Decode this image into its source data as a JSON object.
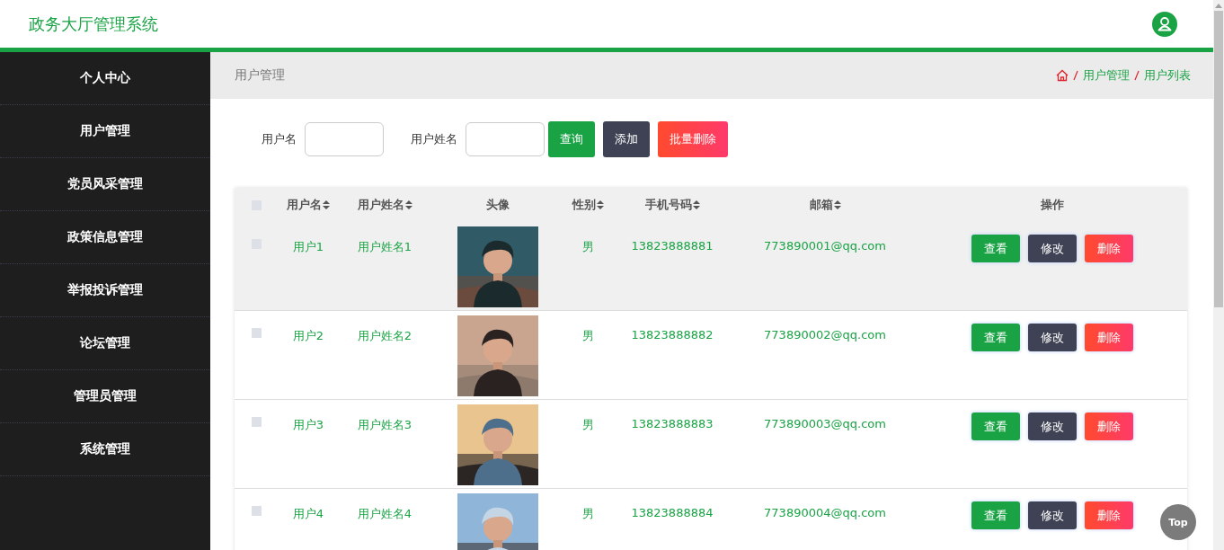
{
  "header": {
    "title": "政务大厅管理系统"
  },
  "sidebar": {
    "items": [
      {
        "label": "个人中心"
      },
      {
        "label": "用户管理"
      },
      {
        "label": "党员风采管理"
      },
      {
        "label": "政策信息管理"
      },
      {
        "label": "举报投诉管理"
      },
      {
        "label": "论坛管理"
      },
      {
        "label": "管理员管理"
      },
      {
        "label": "系统管理"
      }
    ]
  },
  "page_title": "用户管理",
  "breadcrumb": [
    "用户管理",
    "用户列表"
  ],
  "search": {
    "fields": [
      {
        "label": "用户名"
      },
      {
        "label": "用户姓名"
      }
    ],
    "buttons": [
      {
        "label": "查询",
        "kind": "search"
      },
      {
        "label": "添加",
        "kind": "add"
      },
      {
        "label": "批量删除",
        "kind": "delete"
      }
    ]
  },
  "table": {
    "select_all_checked": false,
    "columns": [
      {
        "label": "用户名",
        "sortable": true
      },
      {
        "label": "用户姓名",
        "sortable": true
      },
      {
        "label": "头像",
        "sortable": false
      },
      {
        "label": "性别",
        "sortable": true
      },
      {
        "label": "手机号码",
        "sortable": true
      },
      {
        "label": "邮箱",
        "sortable": true
      },
      {
        "label": "操作",
        "sortable": false
      }
    ],
    "rows": [
      {
        "checked": false,
        "highlighted": true,
        "username": "用户1",
        "name": "用户姓名1",
        "avatar": {
          "kind": "picture"
        },
        "gender": "男",
        "phone": "13823888881",
        "email": "773890001@qq.com",
        "actions": [
          "查看",
          "修改",
          "删除"
        ]
      },
      {
        "checked": false,
        "highlighted": false,
        "username": "用户2",
        "name": "用户姓名2",
        "avatar": {
          "kind": "picture"
        },
        "gender": "男",
        "phone": "13823888882",
        "email": "773890002@qq.com",
        "actions": [
          "查看",
          "修改",
          "删除"
        ]
      },
      {
        "checked": false,
        "highlighted": false,
        "username": "用户3",
        "name": "用户姓名3",
        "avatar": {
          "kind": "picture"
        },
        "gender": "男",
        "phone": "13823888883",
        "email": "773890003@qq.com",
        "actions": [
          "查看",
          "修改",
          "删除"
        ]
      },
      {
        "checked": false,
        "highlighted": false,
        "username": "用户4",
        "name": "用户姓名4",
        "avatar": {
          "kind": "picture"
        },
        "gender": "男",
        "phone": "13823888884",
        "email": "773890004@qq.com",
        "actions": [
          "查看",
          "修改",
          "删除"
        ]
      }
    ]
  },
  "top_button": "Top"
}
